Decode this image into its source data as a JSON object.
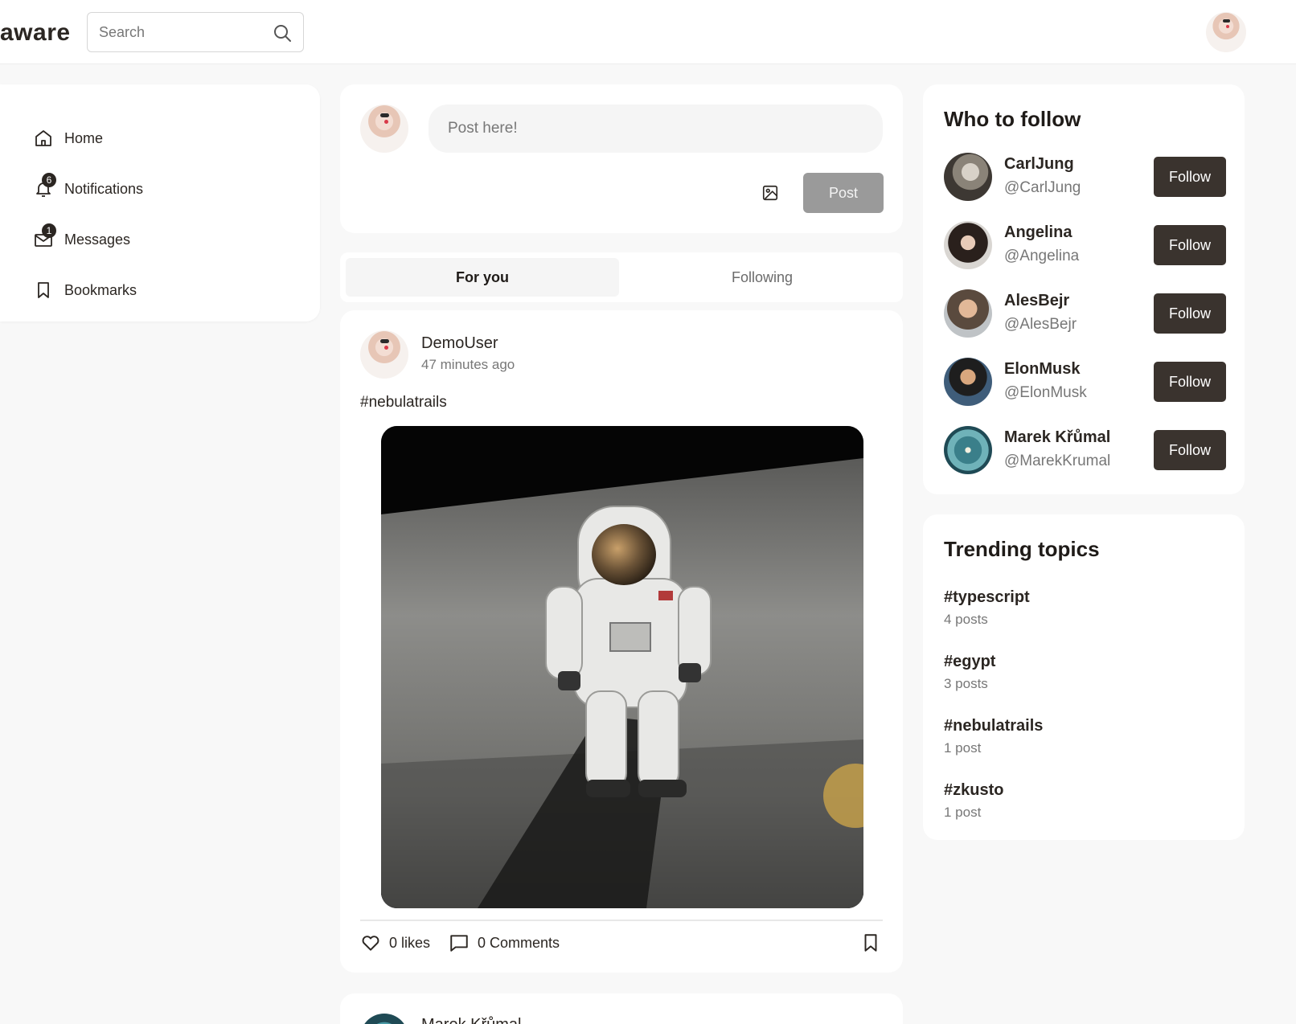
{
  "header": {
    "logo_text": "aware",
    "search": {
      "placeholder": "Search"
    }
  },
  "sidebar": {
    "items": [
      {
        "label": "Home",
        "icon": "home-icon"
      },
      {
        "label": "Notifications",
        "icon": "bell-icon",
        "badge": "6"
      },
      {
        "label": "Messages",
        "icon": "mail-icon",
        "badge": "1"
      },
      {
        "label": "Bookmarks",
        "icon": "bookmark-icon"
      }
    ]
  },
  "composer": {
    "placeholder": "Post here!",
    "post_label": "Post",
    "image_icon": "image-icon"
  },
  "tabs": [
    {
      "label": "For you",
      "active": true
    },
    {
      "label": "Following",
      "active": false
    }
  ],
  "feed": {
    "posts": [
      {
        "author": "DemoUser",
        "time": "47 minutes ago",
        "text": "#nebulatrails",
        "image": "astronaut-on-moon",
        "likes": "0 likes",
        "comments": "0 Comments"
      },
      {
        "author": "Marek Křůmal"
      }
    ]
  },
  "who_to_follow": {
    "title": "Who to follow",
    "users": [
      {
        "name": "CarlJung",
        "handle": "@CarlJung",
        "button": "Follow"
      },
      {
        "name": "Angelina",
        "handle": "@Angelina",
        "button": "Follow"
      },
      {
        "name": "AlesBejr",
        "handle": "@AlesBejr",
        "button": "Follow"
      },
      {
        "name": "ElonMusk",
        "handle": "@ElonMusk",
        "button": "Follow"
      },
      {
        "name": "Marek Křůmal",
        "handle": "@MarekKrumal",
        "button": "Follow"
      }
    ]
  },
  "trending": {
    "title": "Trending topics",
    "topics": [
      {
        "tag": "#typescript",
        "count": "4 posts"
      },
      {
        "tag": "#egypt",
        "count": "3 posts"
      },
      {
        "tag": "#nebulatrails",
        "count": "1 post"
      },
      {
        "tag": "#zkusto",
        "count": "1 post"
      }
    ]
  },
  "colors": {
    "dark_button": "#3a332e",
    "disabled_button": "#9a9a9a",
    "page_bg": "#f8f8f8",
    "text": "#2b2622"
  }
}
